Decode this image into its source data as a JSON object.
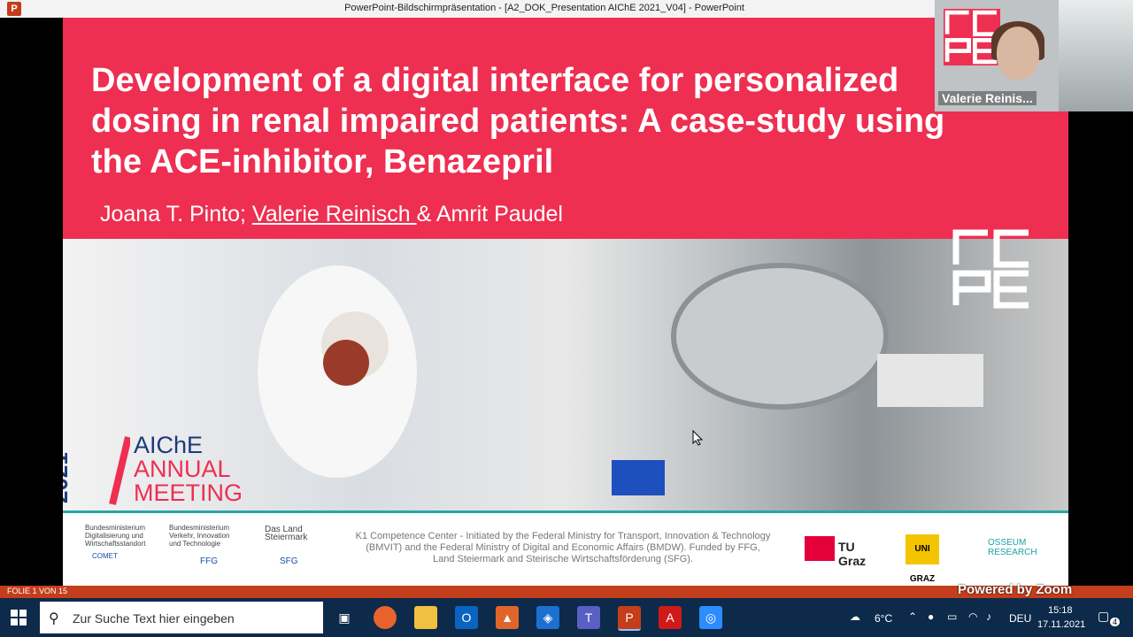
{
  "window": {
    "title": "PowerPoint-Bildschirmpräsentation - [A2_DOK_Presentation AIChE 2021_V04] - PowerPoint",
    "app_icon_letter": "P"
  },
  "slide": {
    "title_line1": "Development of a digital interface for personalized",
    "title_line2": "dosing in renal impaired patients: A case-study using",
    "title_line3": "the ACE-inhibitor, Benazepril",
    "authors_part1": "Joana T. Pinto; ",
    "authors_part2": "Valerie Reinisch ",
    "authors_part3": "& Amrit Paudel",
    "aiche_year": "2021",
    "aiche_line1": "AIChE",
    "aiche_line2": "ANNUAL",
    "aiche_line3": "MEETING",
    "footer_k1": "K1 Competence Center - Initiated by the Federal Ministry for Transport, Innovation & Technology (BMVIT) and the Federal Ministry of Digital and Economic Affairs (BMDW). Funded by FFG, Land Steiermark and Steirische Wirtschaftsförderung (SFG).",
    "sponsor1": "Bundesministerium Digitalisierung und Wirtschaftsstandort",
    "sponsor2": "Bundesministerium Verkehr, Innovation und Technologie",
    "sponsor3": "Das Land Steiermark",
    "comet": "COMET",
    "ffg": "FFG",
    "sfg": "SFG",
    "tu_graz": "TU Graz",
    "uni_graz": "UNI GRAZ",
    "oss": "OSSEUM RESEARCH"
  },
  "zoom": {
    "participant_name": "Valerie Reinis...",
    "watermark": "Powered by Zoom"
  },
  "statusbar": {
    "slide_counter": "FOLIE 1 VON 15"
  },
  "taskbar": {
    "search_placeholder": "Zur Suche Text hier eingeben",
    "temperature": "6°C",
    "language": "DEU",
    "time": "15:18",
    "date": "17.11.2021",
    "notifications": "4"
  },
  "colors": {
    "slide_red": "#ee2f51",
    "accent_teal": "#2aa4a6",
    "status_orange": "#c43e1c",
    "taskbar": "#0d2a4a"
  }
}
